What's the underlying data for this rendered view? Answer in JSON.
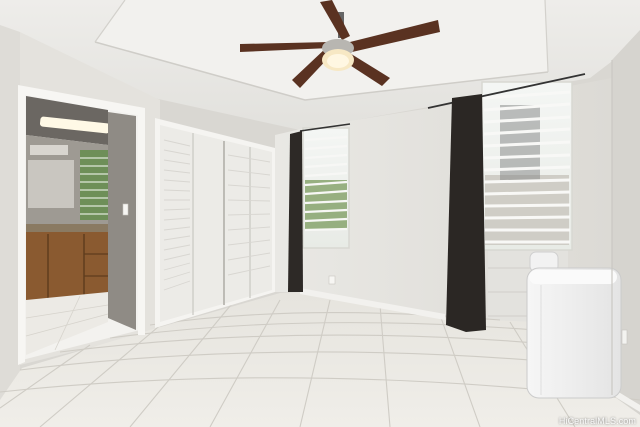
{
  "photo": {
    "watermark": "HiCentralMLS.com"
  }
}
